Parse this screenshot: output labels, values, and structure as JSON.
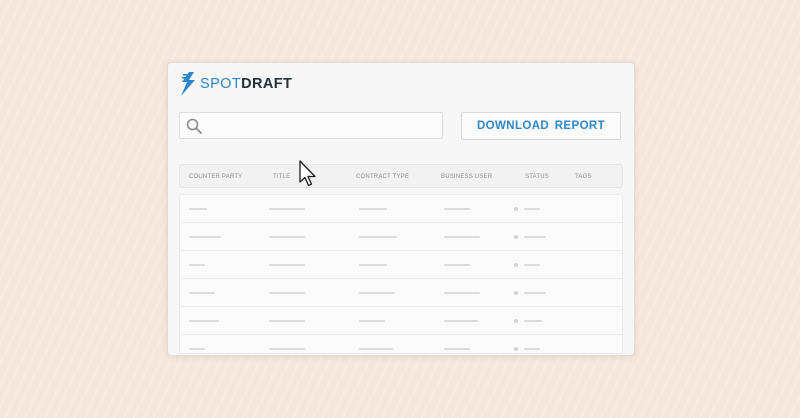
{
  "brand": {
    "spot": "SPOT",
    "draft": "DRAFT"
  },
  "search": {
    "placeholder": ""
  },
  "actions": {
    "download_label": "DOWNLOAD  REPORT"
  },
  "table": {
    "columns": [
      "COUNTER PARTY",
      "TITLE",
      "CONTRACT TYPE",
      "BUSINESS USER",
      "STATUS",
      "TAGS"
    ],
    "rows": 6
  },
  "colors": {
    "accent": "#2f87c9",
    "brand_dark": "#23313f",
    "background": "#f6e7dc"
  },
  "icons": {
    "search": "search-icon",
    "logo": "lightning-bolt-icon",
    "cursor": "mouse-pointer-icon"
  }
}
